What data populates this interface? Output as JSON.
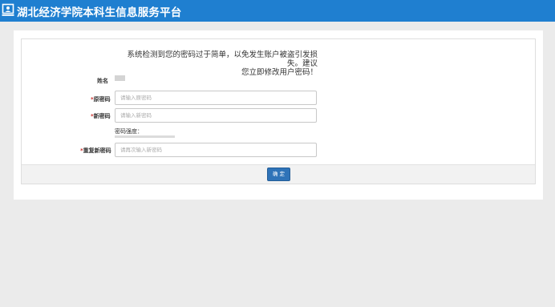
{
  "header": {
    "title": "湖北经济学院本科生信息服务平台",
    "brand_color": "#1f7fd0",
    "icon": "person-card-icon"
  },
  "notice": {
    "line1": "系统检测到您的密码过于简单，以免发生账户被盗引发损失。建议",
    "line2": "您立即修改用户密码！"
  },
  "form": {
    "name_label": "姓名",
    "required_mark": "*",
    "old_password_label": "原密码",
    "old_password_placeholder": "请输入原密码",
    "new_password_label": "新密码",
    "new_password_placeholder": "请输入新密码",
    "strength_label": "密码强度：",
    "confirm_password_label": "重复新密码",
    "confirm_password_placeholder": "请再次输入新密码",
    "submit_label": "确 定",
    "submit_color": "#2f73b8"
  }
}
